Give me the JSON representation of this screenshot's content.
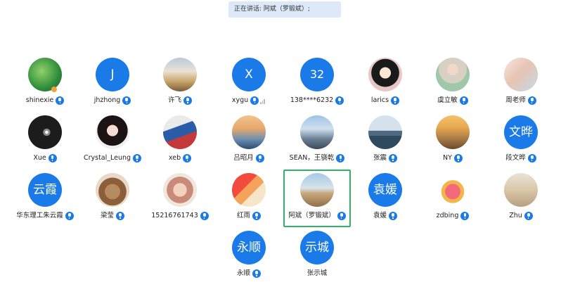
{
  "banner": {
    "text": "正在讲话: 阿斌（罗锻斌）;"
  },
  "participants": [
    {
      "name": "shinexie",
      "type": "photo",
      "bg": "radial-gradient(circle at 40% 40%, #8fd16b, #2f8d3a 60%, #1d5b26)"
    },
    {
      "name": "jhzhong",
      "type": "letter",
      "letter": "J"
    },
    {
      "name": "许飞",
      "type": "photo",
      "bg": "linear-gradient(180deg,#b9c9dc 0%,#e9e3d4 40%,#caa66c 70%,#7a5b39 100%)"
    },
    {
      "name": "xygu",
      "type": "letter",
      "letter": "X",
      "signal": true
    },
    {
      "name": "138****6232",
      "type": "letter",
      "letter": "32"
    },
    {
      "name": "larics",
      "type": "photo",
      "bg": "radial-gradient(circle at 50% 45%, #fbe5d3 0 22%, #1a1a1a 23% 55%, #e9c6c6 56%)"
    },
    {
      "name": "虞立敏",
      "type": "photo",
      "bg": "radial-gradient(circle at 50% 35%, #f1d8c8 0 20%, #d8d0c2 21% 50%, #9fc7a8 51%)"
    },
    {
      "name": "周老师",
      "type": "photo",
      "bg": "linear-gradient(135deg,#f7e7dd 0%,#e8c4b3 45%,#c2d8e8 100%)"
    },
    {
      "name": "Xue",
      "type": "photo",
      "bg": "radial-gradient(circle at 55% 50%, #f5f5f5 0 6%, #8a8a8a 7% 14%, #1c1c1c 15%)"
    },
    {
      "name": "Crystal_Leung",
      "type": "photo",
      "bg": "radial-gradient(circle at 50% 45%, #f6dcd4 0 22%, #1c1414 23% 60%, #f0f0f0 61%)"
    },
    {
      "name": "xeb",
      "type": "photo",
      "bg": "linear-gradient(160deg,#eaeaea 0 35%,#2a5ca8 36% 60%,#c43a3a 61%)"
    },
    {
      "name": "吕昭月",
      "type": "photo",
      "bg": "linear-gradient(180deg,#f2c38c 0%,#e6a76a 40%,#6d8fb3 70%,#2d4c6e 100%)"
    },
    {
      "name": "SEAN，王骁乾",
      "type": "photo",
      "bg": "linear-gradient(180deg,#9ec3e6 0%,#cfe0ef 40%,#6b7f92 70%,#3a4a5a 100%)"
    },
    {
      "name": "张震",
      "type": "photo",
      "bg": "linear-gradient(180deg,#d5e2ec 0 45%,#4f6a7f 46% 60%,#2f4a5f 61%)"
    },
    {
      "name": "NY",
      "type": "photo",
      "bg": "linear-gradient(180deg,#f5c16a 0%,#e8a84f 35%,#a67a45 70%,#6b4a2a 100%)"
    },
    {
      "name": "段文晔",
      "type": "letter",
      "letter": "文晔"
    },
    {
      "name": "华东理工朱云霞",
      "type": "letter",
      "letter": "云霞"
    },
    {
      "name": "梁莹",
      "type": "photo",
      "bg": "radial-gradient(circle at 50% 55%, #b78a5f 0 30%, #8c5f3b 31% 55%, #e8d9c8 56%)"
    },
    {
      "name": "15216761743",
      "type": "photo",
      "bg": "radial-gradient(circle at 50% 50%, #f2d3c0 0 28%, #c98a7a 29% 55%, #efe6dc 56%)"
    },
    {
      "name": "红雨",
      "type": "photo",
      "bg": "linear-gradient(135deg,#f24a3c 0 40%,#f5a35a 41% 60%,#f7e5c9 61%)"
    },
    {
      "name": "阿斌（罗锻斌）",
      "type": "photo",
      "active": true,
      "bg": "linear-gradient(180deg,#a8c9e6 0%,#d6e3ea 45%,#c8a77a 60%,#8f6f4a 100%)"
    },
    {
      "name": "袁媛",
      "type": "letter",
      "letter": "袁媛"
    },
    {
      "name": "zdbing",
      "type": "photo",
      "bg": "radial-gradient(circle at 50% 55%, #f06a7a 0 30%, #f5b44a 31% 45%, #ffffff 46%)"
    },
    {
      "name": "Zhu",
      "type": "photo",
      "bg": "linear-gradient(180deg,#e9e3d6 0%,#d9c7a8 50%,#b8a082 100%)"
    },
    {
      "name": "永顺",
      "type": "letter",
      "letter": "永顺"
    },
    {
      "name": "张示城",
      "type": "letter",
      "letter": "示城",
      "nomic": true
    }
  ],
  "icons": {
    "mic": "microphone-icon",
    "signal": "signal-strength-icon"
  },
  "colors": {
    "accent": "#1a7ae8",
    "active_border": "#2fb36b",
    "banner_bg": "#dde9f8"
  }
}
